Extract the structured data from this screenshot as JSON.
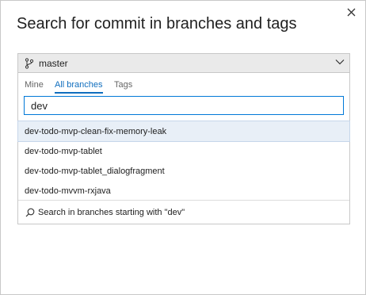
{
  "dialog": {
    "title": "Search for commit in branches and tags"
  },
  "picker": {
    "selected_branch": "master",
    "tabs": [
      {
        "label": "Mine",
        "active": false
      },
      {
        "label": "All branches",
        "active": true
      },
      {
        "label": "Tags",
        "active": false
      }
    ],
    "search_value": "dev",
    "results": [
      {
        "label": "dev-todo-mvp-clean-fix-memory-leak",
        "selected": true
      },
      {
        "label": "dev-todo-mvp-tablet",
        "selected": false
      },
      {
        "label": "dev-todo-mvp-tablet_dialogfragment",
        "selected": false
      },
      {
        "label": "dev-todo-mvvm-rxjava",
        "selected": false
      }
    ],
    "search_more_label": "Search in branches starting with \"dev\""
  },
  "colors": {
    "accent": "#0078d7",
    "active_tab": "#106ebe",
    "selected_row": "#e8eff7",
    "header_bg": "#eaeaea"
  }
}
